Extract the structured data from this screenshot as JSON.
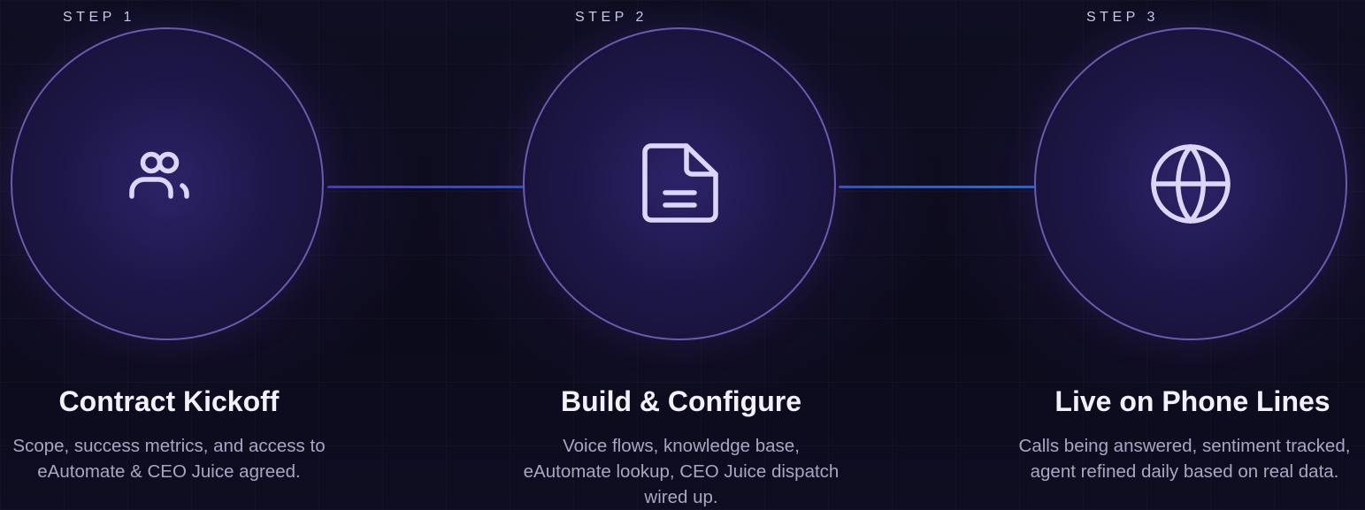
{
  "steps": [
    {
      "label": "STEP 1",
      "icon": "users-icon",
      "title": "Contract Kickoff",
      "description": "Scope, success metrics, and access to eAutomate & CEO Juice agreed."
    },
    {
      "label": "STEP 2",
      "icon": "document-icon",
      "title": "Build & Configure",
      "description": "Voice flows, knowledge base, eAutomate lookup, CEO Juice dispatch wired up."
    },
    {
      "label": "STEP 3",
      "icon": "globe-icon",
      "title": "Live on Phone Lines",
      "description": "Calls being answered, sentiment tracked, agent refined daily based on real data."
    }
  ],
  "colors": {
    "background": "#0d0c1c",
    "circle_border": "#6b5bb0",
    "circle_fill": "#1d1748",
    "icon_stroke": "#ddd6fb",
    "connector": "#4a3fa0",
    "title": "#f2f0fb",
    "description": "#a9a5c4",
    "step_label": "#cfc8ee"
  }
}
